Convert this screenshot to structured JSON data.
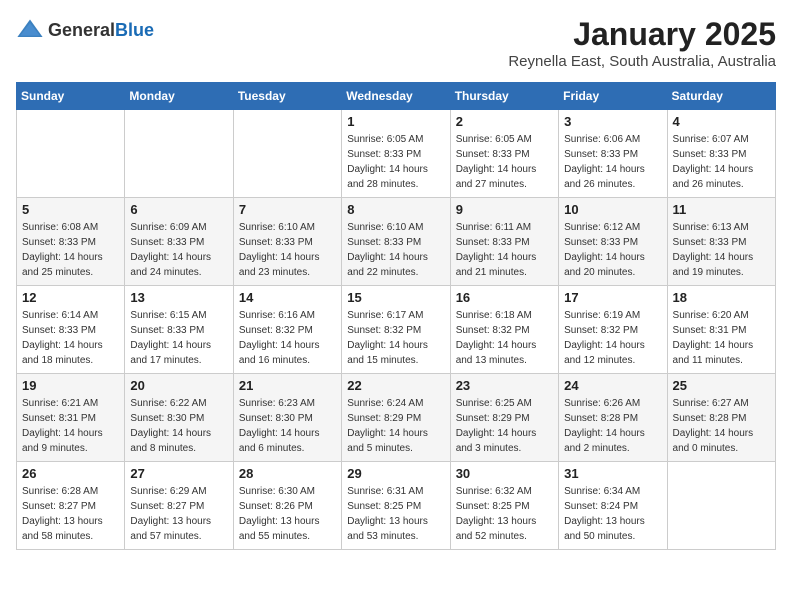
{
  "header": {
    "logo_general": "General",
    "logo_blue": "Blue",
    "month": "January 2025",
    "location": "Reynella East, South Australia, Australia"
  },
  "days_of_week": [
    "Sunday",
    "Monday",
    "Tuesday",
    "Wednesday",
    "Thursday",
    "Friday",
    "Saturday"
  ],
  "weeks": [
    [
      {
        "day": "",
        "info": ""
      },
      {
        "day": "",
        "info": ""
      },
      {
        "day": "",
        "info": ""
      },
      {
        "day": "1",
        "info": "Sunrise: 6:05 AM\nSunset: 8:33 PM\nDaylight: 14 hours\nand 28 minutes."
      },
      {
        "day": "2",
        "info": "Sunrise: 6:05 AM\nSunset: 8:33 PM\nDaylight: 14 hours\nand 27 minutes."
      },
      {
        "day": "3",
        "info": "Sunrise: 6:06 AM\nSunset: 8:33 PM\nDaylight: 14 hours\nand 26 minutes."
      },
      {
        "day": "4",
        "info": "Sunrise: 6:07 AM\nSunset: 8:33 PM\nDaylight: 14 hours\nand 26 minutes."
      }
    ],
    [
      {
        "day": "5",
        "info": "Sunrise: 6:08 AM\nSunset: 8:33 PM\nDaylight: 14 hours\nand 25 minutes."
      },
      {
        "day": "6",
        "info": "Sunrise: 6:09 AM\nSunset: 8:33 PM\nDaylight: 14 hours\nand 24 minutes."
      },
      {
        "day": "7",
        "info": "Sunrise: 6:10 AM\nSunset: 8:33 PM\nDaylight: 14 hours\nand 23 minutes."
      },
      {
        "day": "8",
        "info": "Sunrise: 6:10 AM\nSunset: 8:33 PM\nDaylight: 14 hours\nand 22 minutes."
      },
      {
        "day": "9",
        "info": "Sunrise: 6:11 AM\nSunset: 8:33 PM\nDaylight: 14 hours\nand 21 minutes."
      },
      {
        "day": "10",
        "info": "Sunrise: 6:12 AM\nSunset: 8:33 PM\nDaylight: 14 hours\nand 20 minutes."
      },
      {
        "day": "11",
        "info": "Sunrise: 6:13 AM\nSunset: 8:33 PM\nDaylight: 14 hours\nand 19 minutes."
      }
    ],
    [
      {
        "day": "12",
        "info": "Sunrise: 6:14 AM\nSunset: 8:33 PM\nDaylight: 14 hours\nand 18 minutes."
      },
      {
        "day": "13",
        "info": "Sunrise: 6:15 AM\nSunset: 8:33 PM\nDaylight: 14 hours\nand 17 minutes."
      },
      {
        "day": "14",
        "info": "Sunrise: 6:16 AM\nSunset: 8:32 PM\nDaylight: 14 hours\nand 16 minutes."
      },
      {
        "day": "15",
        "info": "Sunrise: 6:17 AM\nSunset: 8:32 PM\nDaylight: 14 hours\nand 15 minutes."
      },
      {
        "day": "16",
        "info": "Sunrise: 6:18 AM\nSunset: 8:32 PM\nDaylight: 14 hours\nand 13 minutes."
      },
      {
        "day": "17",
        "info": "Sunrise: 6:19 AM\nSunset: 8:32 PM\nDaylight: 14 hours\nand 12 minutes."
      },
      {
        "day": "18",
        "info": "Sunrise: 6:20 AM\nSunset: 8:31 PM\nDaylight: 14 hours\nand 11 minutes."
      }
    ],
    [
      {
        "day": "19",
        "info": "Sunrise: 6:21 AM\nSunset: 8:31 PM\nDaylight: 14 hours\nand 9 minutes."
      },
      {
        "day": "20",
        "info": "Sunrise: 6:22 AM\nSunset: 8:30 PM\nDaylight: 14 hours\nand 8 minutes."
      },
      {
        "day": "21",
        "info": "Sunrise: 6:23 AM\nSunset: 8:30 PM\nDaylight: 14 hours\nand 6 minutes."
      },
      {
        "day": "22",
        "info": "Sunrise: 6:24 AM\nSunset: 8:29 PM\nDaylight: 14 hours\nand 5 minutes."
      },
      {
        "day": "23",
        "info": "Sunrise: 6:25 AM\nSunset: 8:29 PM\nDaylight: 14 hours\nand 3 minutes."
      },
      {
        "day": "24",
        "info": "Sunrise: 6:26 AM\nSunset: 8:28 PM\nDaylight: 14 hours\nand 2 minutes."
      },
      {
        "day": "25",
        "info": "Sunrise: 6:27 AM\nSunset: 8:28 PM\nDaylight: 14 hours\nand 0 minutes."
      }
    ],
    [
      {
        "day": "26",
        "info": "Sunrise: 6:28 AM\nSunset: 8:27 PM\nDaylight: 13 hours\nand 58 minutes."
      },
      {
        "day": "27",
        "info": "Sunrise: 6:29 AM\nSunset: 8:27 PM\nDaylight: 13 hours\nand 57 minutes."
      },
      {
        "day": "28",
        "info": "Sunrise: 6:30 AM\nSunset: 8:26 PM\nDaylight: 13 hours\nand 55 minutes."
      },
      {
        "day": "29",
        "info": "Sunrise: 6:31 AM\nSunset: 8:25 PM\nDaylight: 13 hours\nand 53 minutes."
      },
      {
        "day": "30",
        "info": "Sunrise: 6:32 AM\nSunset: 8:25 PM\nDaylight: 13 hours\nand 52 minutes."
      },
      {
        "day": "31",
        "info": "Sunrise: 6:34 AM\nSunset: 8:24 PM\nDaylight: 13 hours\nand 50 minutes."
      },
      {
        "day": "",
        "info": ""
      }
    ]
  ]
}
